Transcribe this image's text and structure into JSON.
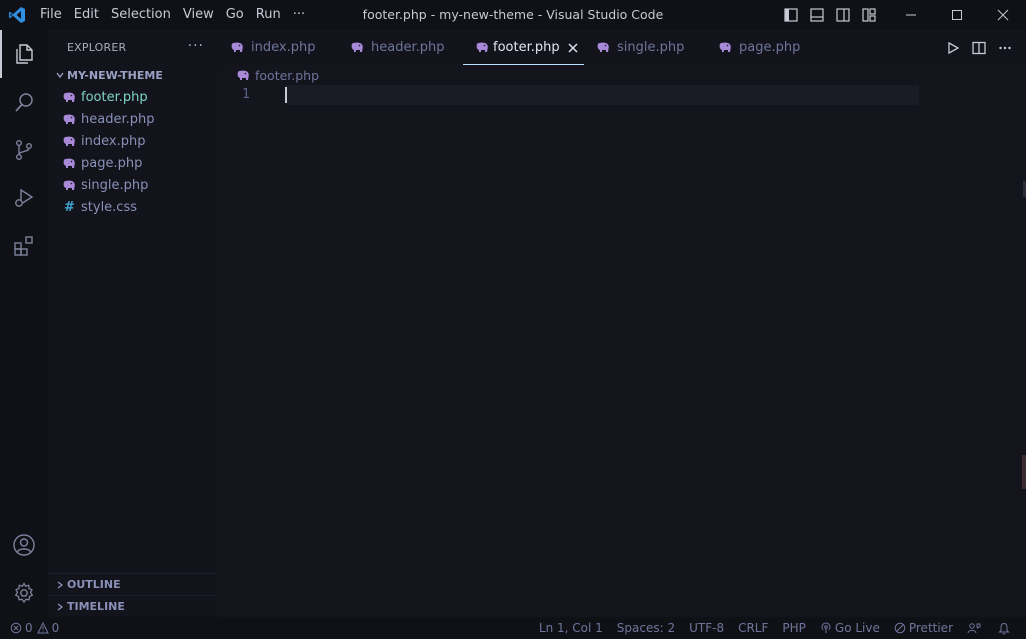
{
  "titlebar": {
    "menu": [
      "File",
      "Edit",
      "Selection",
      "View",
      "Go",
      "Run",
      "···"
    ],
    "window_title": "footer.php - my-new-theme - Visual Studio Code"
  },
  "sidebar": {
    "header": "EXPLORER",
    "more": "···",
    "folder": "MY-NEW-THEME",
    "files": [
      {
        "name": "footer.php",
        "icon": "php-elephant-icon"
      },
      {
        "name": "header.php",
        "icon": "php-elephant-icon"
      },
      {
        "name": "index.php",
        "icon": "php-elephant-icon"
      },
      {
        "name": "page.php",
        "icon": "php-elephant-icon"
      },
      {
        "name": "single.php",
        "icon": "php-elephant-icon"
      },
      {
        "name": "style.css",
        "icon": "css-hash-icon"
      }
    ],
    "panels": [
      "OUTLINE",
      "TIMELINE"
    ]
  },
  "editor": {
    "tabs": [
      {
        "label": "index.php"
      },
      {
        "label": "header.php"
      },
      {
        "label": "footer.php"
      },
      {
        "label": "single.php"
      },
      {
        "label": "page.php"
      }
    ],
    "active_tab": "footer.php",
    "breadcrumb": "footer.php",
    "line_numbers": [
      "1"
    ]
  },
  "statusbar": {
    "errors": "0",
    "warnings": "0",
    "position": "Ln 1, Col 1",
    "spaces": "Spaces: 2",
    "encoding": "UTF-8",
    "eol": "CRLF",
    "language": "PHP",
    "go_live": "Go Live",
    "prettier": "Prettier"
  },
  "colors": {
    "background": "#13141c",
    "chrome": "#101117",
    "php_icon": "#a889d8",
    "css_icon": "#3fa7d6",
    "active_file": "#7fd3c8",
    "vscode_blue": "#2f8fe0"
  }
}
